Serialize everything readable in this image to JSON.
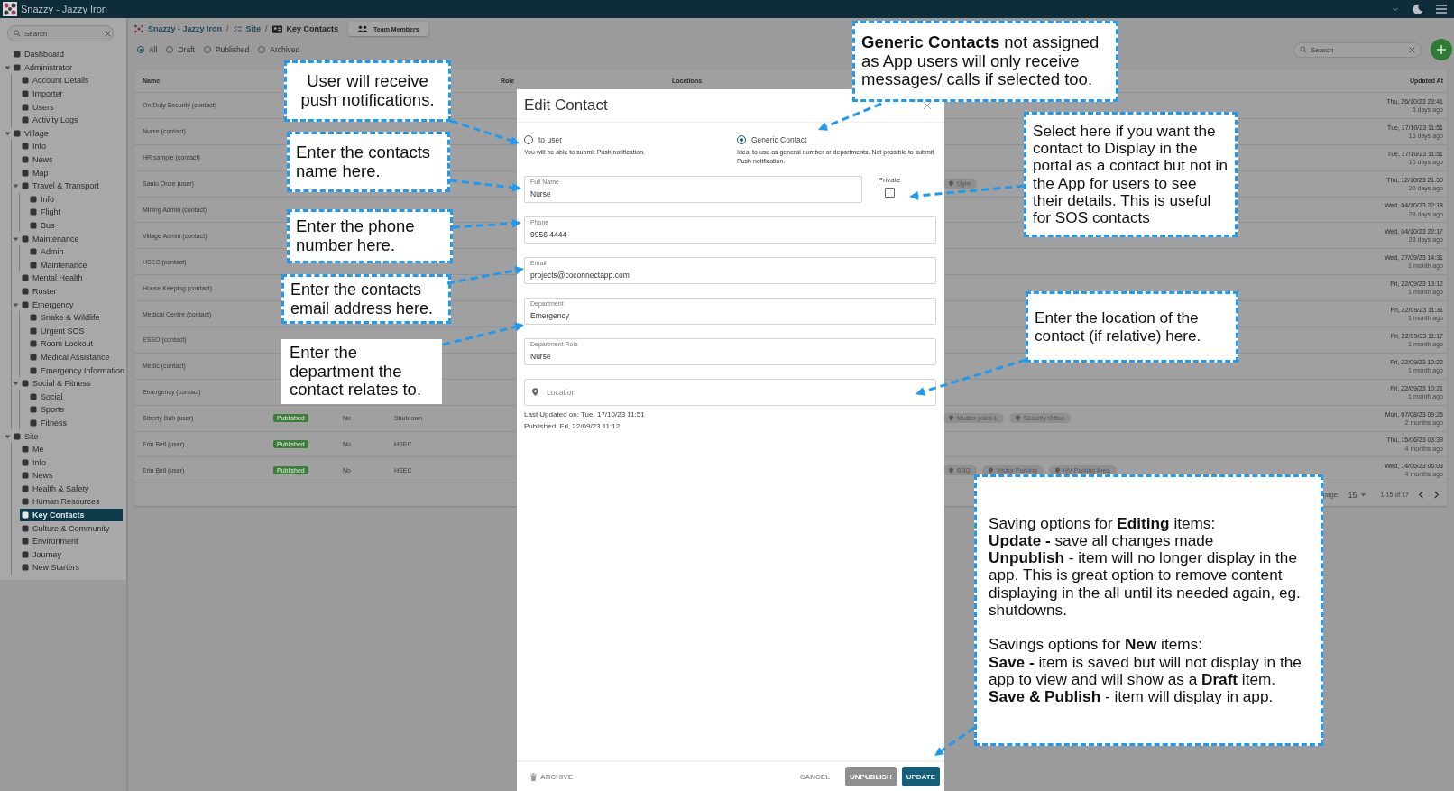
{
  "window": {
    "title": "Snazzy - Jazzy Iron"
  },
  "sidebar": {
    "search": {
      "placeholder": "Search"
    },
    "items": [
      {
        "label": "Dashboard",
        "selected": false
      },
      {
        "label": "Administrator",
        "selected": false,
        "expanded": true,
        "children": [
          {
            "label": "Account Details",
            "selected": false
          },
          {
            "label": "Importer",
            "selected": false
          },
          {
            "label": "Users",
            "selected": false
          },
          {
            "label": "Activity Logs",
            "selected": false
          }
        ]
      },
      {
        "label": "Village",
        "selected": false,
        "expanded": true,
        "children": [
          {
            "label": "Info",
            "selected": false
          },
          {
            "label": "News",
            "selected": false
          },
          {
            "label": "Map",
            "selected": false
          },
          {
            "label": "Travel & Transport",
            "selected": false,
            "expanded": true,
            "children": [
              {
                "label": "Info",
                "selected": false
              },
              {
                "label": "Flight",
                "selected": false
              },
              {
                "label": "Bus",
                "selected": false
              }
            ]
          },
          {
            "label": "Maintenance",
            "selected": false,
            "expanded": true,
            "children": [
              {
                "label": "Admin",
                "selected": false
              },
              {
                "label": "Maintenance",
                "selected": false
              }
            ]
          },
          {
            "label": "Mental Health",
            "selected": false
          },
          {
            "label": "Roster",
            "selected": false
          },
          {
            "label": "Emergency",
            "selected": false,
            "expanded": true,
            "children": [
              {
                "label": "Snake & Wildlife",
                "selected": false
              },
              {
                "label": "Urgent SOS",
                "selected": false
              },
              {
                "label": "Room Lockout",
                "selected": false
              },
              {
                "label": "Medical Assistance",
                "selected": false
              },
              {
                "label": "Emergency Information",
                "selected": false
              }
            ]
          },
          {
            "label": "Social & Fitness",
            "selected": false,
            "expanded": true,
            "children": [
              {
                "label": "Social",
                "selected": false
              },
              {
                "label": "Sports",
                "selected": false
              },
              {
                "label": "Fitness",
                "selected": false
              }
            ]
          }
        ]
      },
      {
        "label": "Site",
        "selected": false,
        "expanded": true,
        "children": [
          {
            "label": "Me",
            "selected": false
          },
          {
            "label": "Info",
            "selected": false
          },
          {
            "label": "News",
            "selected": false
          },
          {
            "label": "Health & Safety",
            "selected": false
          },
          {
            "label": "Human Resources",
            "selected": false
          },
          {
            "label": "Key Contacts",
            "selected": true
          },
          {
            "label": "Culture & Community",
            "selected": false
          },
          {
            "label": "Environment",
            "selected": false
          },
          {
            "label": "Journey",
            "selected": false
          },
          {
            "label": "New Starters",
            "selected": false
          }
        ]
      }
    ]
  },
  "breadcrumb": [
    "Snazzy - Jazzy Iron",
    "Site",
    "Key Contacts"
  ],
  "breadcrumb_separator": "/",
  "team_button": "Team Members",
  "filters": [
    {
      "label": "All",
      "selected": true
    },
    {
      "label": "Draft",
      "selected": false
    },
    {
      "label": "Published",
      "selected": false
    },
    {
      "label": "Archived",
      "selected": false
    }
  ],
  "search": {
    "placeholder": "Search"
  },
  "table": {
    "columns": [
      "Name",
      "Role",
      "Locations",
      "Updated At"
    ],
    "rows": [
      {
        "name": "On Duty Security (contact)",
        "updated": "Thu, 26/10/23 23:41",
        "ago": "6 days ago"
      },
      {
        "name": "Nurse (contact)",
        "updated": "Tue, 17/10/23 11:51",
        "ago": "16 days ago"
      },
      {
        "name": "HR sample (contact)",
        "updated": "Tue, 17/10/23 11:51",
        "ago": "16 days ago"
      },
      {
        "name": "Saulo Onze (user)",
        "locations": [
          "Gym"
        ],
        "updated": "Thu, 12/10/23 21:50",
        "ago": "20 days ago"
      },
      {
        "name": "Mining Admin (contact)",
        "updated": "Wed, 04/10/23 22:18",
        "ago": "28 days ago"
      },
      {
        "name": "Village Admin (contact)",
        "updated": "Wed, 04/10/23 22:17",
        "ago": "28 days ago"
      },
      {
        "name": "HSEC (contact)",
        "updated": "Wed, 27/09/23 14:31",
        "ago": "1 month ago"
      },
      {
        "name": "House Keeping (contact)",
        "updated": "Fri, 22/09/23 13:12",
        "ago": "1 month ago"
      },
      {
        "name": "Medical Centre (contact)",
        "updated": "Fri, 22/09/23 11:31",
        "ago": "1 month ago"
      },
      {
        "name": "ESSO (contact)",
        "updated": "Fri, 22/09/23 11:17",
        "ago": "1 month ago"
      },
      {
        "name": "Medic (contact)",
        "updated": "Fri, 22/09/23 10:22",
        "ago": "1 month ago"
      },
      {
        "name": "Emergency (contact)",
        "updated": "Fri, 22/09/23 10:21",
        "ago": "1 month ago"
      },
      {
        "name": "Biberty Bob (user)",
        "status": "Published",
        "column_3": "No",
        "column_4": "Shutdown",
        "locations": [
          "Muster point-1",
          "Security Office"
        ],
        "updated": "Mon, 07/08/23 09:25",
        "ago": "2 months ago"
      },
      {
        "name": "Erin Bell (user)",
        "status": "Published",
        "column_3": "No",
        "column_4": "HSEC",
        "updated": "Thu, 15/06/23 03:39",
        "ago": "4 months ago"
      },
      {
        "name": "Erin Bell (user)",
        "status": "Published",
        "column_3": "No",
        "column_4": "HSEC",
        "locations": [
          "BBQ",
          "Visitor Parking",
          "HV Parking Area"
        ],
        "updated": "Wed, 14/06/23 06:03",
        "ago": "4 months ago"
      }
    ],
    "pagination": {
      "label": "page:",
      "per_page": "15",
      "range": "1-15 of 17"
    }
  },
  "modal": {
    "title": "Edit Contact",
    "types": [
      {
        "label": "to user",
        "hint": "You will be able to submit Push notification.",
        "selected": false
      },
      {
        "label": "Generic Contact",
        "hint": "Ideal to use as general number or departments. Not possible to submit Push notification.",
        "selected": true
      }
    ],
    "fields": [
      {
        "label": "Full Name",
        "value": "Nurse"
      },
      {
        "label": "Phone",
        "value": "9956 4444"
      },
      {
        "label": "Email",
        "value": "projects@coconnectapp.com"
      },
      {
        "label": "Department",
        "value": "Emergency"
      },
      {
        "label": "Department Role",
        "value": "Nurse"
      }
    ],
    "private": {
      "label": "Private",
      "checked": false
    },
    "location": {
      "placeholder": "Location"
    },
    "meta": [
      "Last Updated on: Tue, 17/10/23 11:51",
      "Published: Fri, 22/09/23 11:12"
    ],
    "buttons": [
      {
        "label": "ARCHIVE",
        "kind": "archive"
      },
      {
        "label": "CANCEL",
        "kind": "text"
      },
      {
        "label": "UNPUBLISH",
        "kind": "secondary"
      },
      {
        "label": "UPDATE",
        "kind": "primary"
      }
    ]
  },
  "callouts": [
    {
      "text": "User will receive push notifications.",
      "color": "#1e9bf0"
    },
    {
      "text": "Enter the contacts name here.",
      "color": "#1e9bf0"
    },
    {
      "text": "Enter the phone number here.",
      "color": "#1e9bf0"
    },
    {
      "text": "Enter the contacts email address here.",
      "color": "#1e9bf0"
    },
    {
      "text": "Enter the department the contact relates to.",
      "color": "#ffffff"
    },
    {
      "text": "**Generic Contacts** not assigned as App users will only receive messages/ calls if selected too.",
      "color": "#1e9bf0"
    },
    {
      "text": "Select here if you want the contact to Display in the portal as a contact but not in the App for users to see their details. This is useful for SOS contacts",
      "color": "#1e9bf0"
    },
    {
      "text": "Enter the location of the contact (if relative) here.",
      "color": "#1e9bf0"
    }
  ],
  "saving_note": {
    "color": "#1e9bf0",
    "blocks": [
      [
        "Saving options for **Editing** items:",
        "**Update -** save all changes made",
        "**Unpublish** - item will no longer display in the app. This is great option to remove content displaying in the all until its needed again, eg. shutdowns."
      ],
      [
        "Savings options for **New** items:",
        "**Save -** item is saved but will not display in the app to view and will show as a **Draft** item.",
        "**Save & Publish** - item will display in app."
      ]
    ]
  }
}
